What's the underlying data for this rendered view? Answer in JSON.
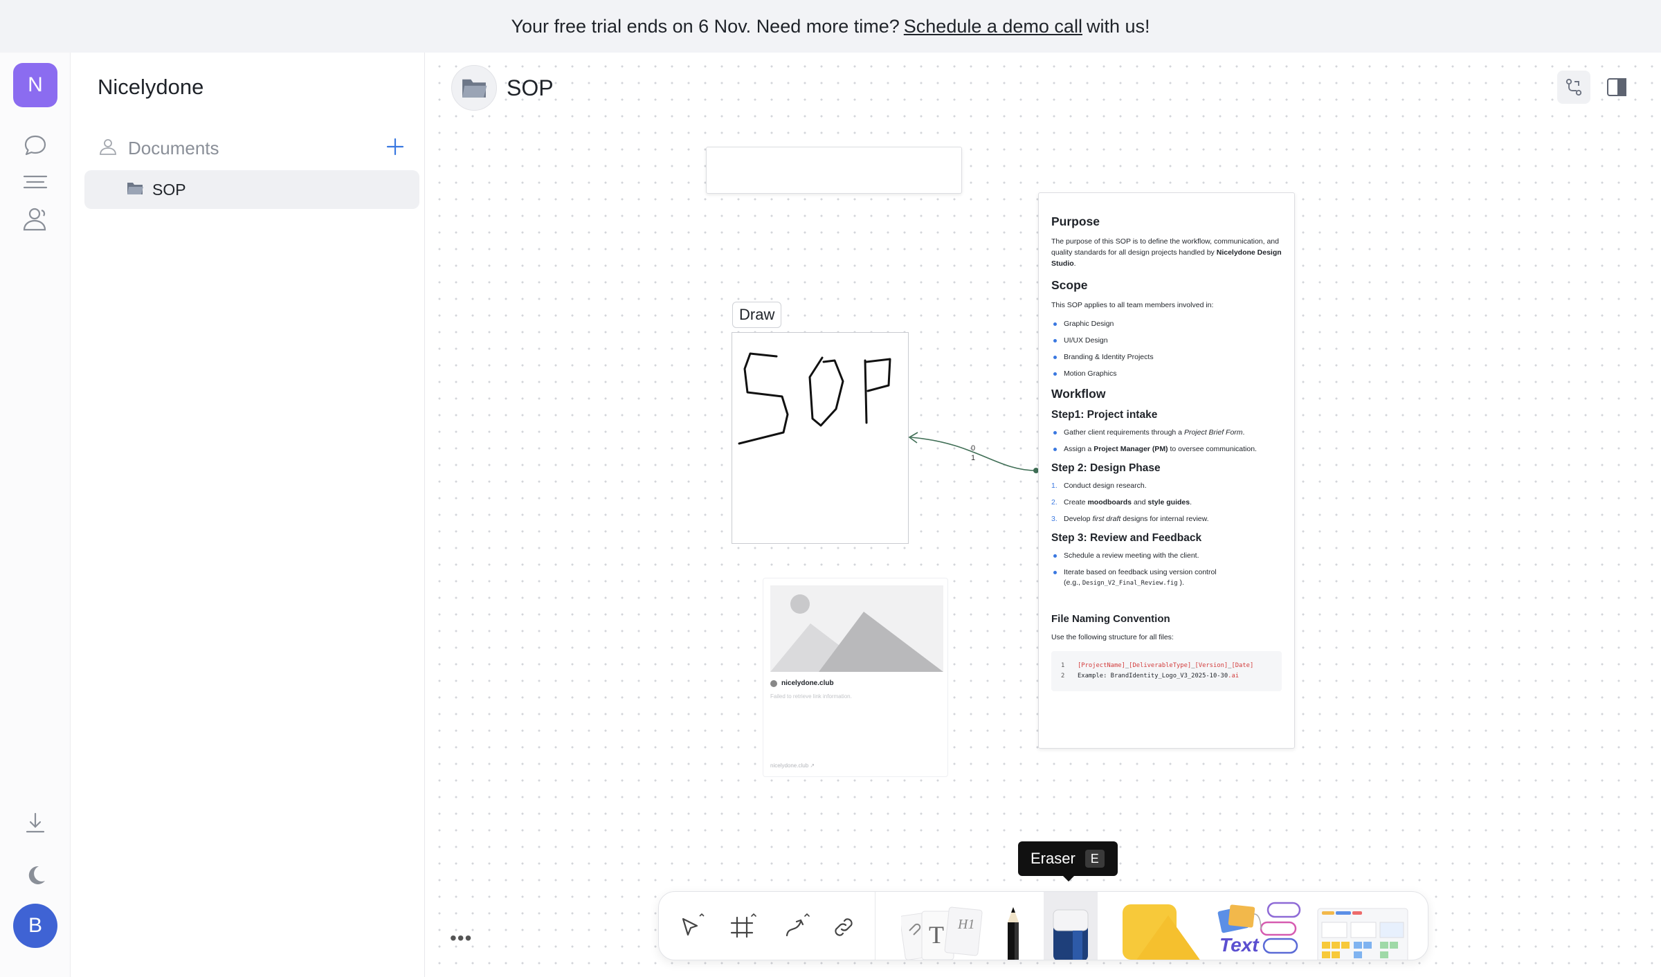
{
  "banner": {
    "text_before": "Your free trial ends on 6 Nov. Need more time?",
    "link_text": "Schedule a demo call",
    "text_after": "with us!"
  },
  "rail": {
    "workspace_initial": "N",
    "user_initial": "B",
    "icons": [
      "chat-icon",
      "menu-icon",
      "people-icon",
      "download-icon",
      "moon-icon"
    ]
  },
  "sidebar": {
    "workspace_name": "Nicelydone",
    "section_label": "Documents",
    "documents": [
      {
        "label": "SOP"
      }
    ]
  },
  "page": {
    "title": "SOP"
  },
  "canvas": {
    "draw_label": "Draw",
    "connector_labels": [
      "0",
      "1"
    ],
    "link_card": {
      "title": "nicelydone.club",
      "subtitle": "Failed to retrieve link information.",
      "footer": "nicelydone.club"
    }
  },
  "doc_card": {
    "purpose_title": "Purpose",
    "purpose_text_1": "The purpose of this SOP is to define the workflow, communication, and quality standards for all design projects handled by",
    "purpose_text_bold": "Nicelydone Design Studio",
    "purpose_text_end": ".",
    "scope_title": "Scope",
    "scope_intro": "This SOP applies to all team members involved in:",
    "scope_items": [
      "Graphic Design",
      "UI/UX Design",
      "Branding & Identity Projects",
      "Motion Graphics"
    ],
    "workflow_title": "Workflow",
    "step1_title": "Step1: Project intake",
    "step1_item1_a": "Gather client requirements through a",
    "step1_item1_b": "Project Brief Form",
    "step1_item1_c": ".",
    "step1_item2_a": "Assign a",
    "step1_item2_b": "Project Manager (PM)",
    "step1_item2_c": "to oversee communication.",
    "step2_title": "Step 2: Design Phase",
    "step2_nums": [
      "1.",
      "2.",
      "3."
    ],
    "step2_item1": "Conduct design research.",
    "step2_item2_a": "Create",
    "step2_item2_b": "moodboards",
    "step2_item2_c": "and",
    "step2_item2_d": "style guides",
    "step2_item2_e": ".",
    "step2_item3_a": "Develop",
    "step2_item3_b": "first draft",
    "step2_item3_c": "designs for internal review.",
    "step3_title": "Step 3: Review and Feedback",
    "step3_item1": "Schedule a review meeting with the client.",
    "step3_item2_a": "Iterate based on feedback using version control",
    "step3_item2_b": "(e.g.,",
    "step3_item2_code": "Design_V2_Final_Review.fig",
    "step3_item2_c": ").",
    "naming_title": "File Naming Convention",
    "naming_intro": "Use the following structure for all files:",
    "code_line1_num": "1",
    "code_line1_parts": [
      "[ProjectName]",
      "_",
      "[DeliverableType]",
      "_",
      "[Version]",
      "_",
      "[Date]"
    ],
    "code_line2_num": "2",
    "code_line2_a": "Example: BrandIdentity_Logo_V3_2025-10-30",
    "code_line2_b": ".ai"
  },
  "tooltip": {
    "label": "Eraser",
    "shortcut": "E"
  },
  "toolbar": {
    "tools": [
      "select-tool",
      "frame-tool",
      "connector-tool",
      "link-tool",
      "text-tool",
      "pen-tool",
      "eraser-tool",
      "shape-tool",
      "template-tool",
      "table-tool"
    ],
    "active_tool": "eraser-tool",
    "text_tool_label": "H1"
  },
  "colors": {
    "workspace_avatar": "#8b6cf0",
    "user_avatar": "#3f63d4",
    "accent": "#3a78e0",
    "connector": "#3f6e55",
    "shape_yellow": "#f7c93a"
  }
}
